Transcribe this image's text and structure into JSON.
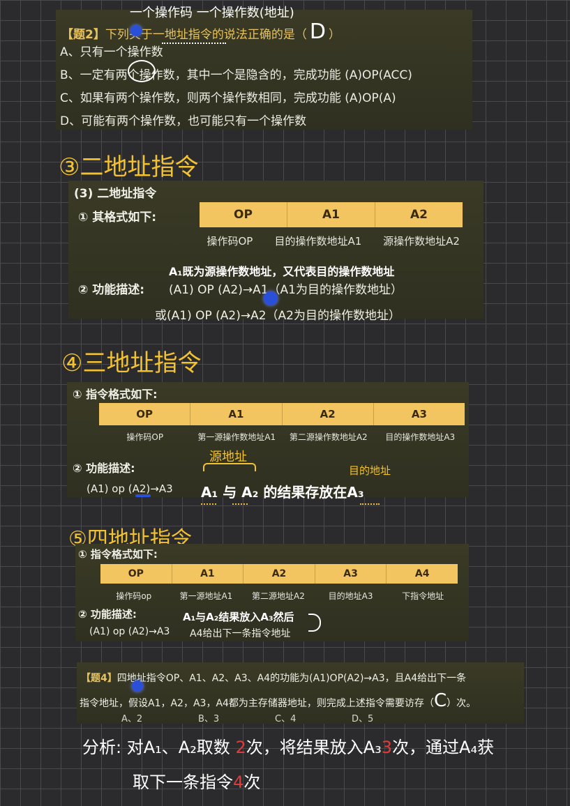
{
  "q2": {
    "annotation": "一个操作码 一个操作数(地址)",
    "title_tag": "【题2】",
    "title": "下列关于一地址指令的说法正确的是（",
    "answer": "D",
    "title_end": "）",
    "options": [
      "A、只有一个操作数",
      "B、一定有两个操作数，其中一个是隐含的，完成功能 (A)OP(ACC)",
      "C、如果有两个操作数，则两个操作数相同，完成功能 (A)OP(A)",
      "D、可能有两个操作数，也可能只有一个操作数"
    ]
  },
  "s3": {
    "heading": "③二地址指令",
    "panel_title": "(3) 二地址指令",
    "format_label": "① 其格式如下:",
    "fields": [
      "OP",
      "A1",
      "A2"
    ],
    "field_labels": [
      "操作码OP",
      "目的操作数地址A1",
      "源操作数地址A2"
    ],
    "note": "A₁既为源操作数地址，又代表目的操作数地址",
    "func_label": "② 功能描述:",
    "func1": "(A1) OP (A2)→A1（A1为目的操作数地址）",
    "func2": "或(A1) OP (A2)→A2（A2为目的操作数地址）"
  },
  "s4": {
    "heading": "④三地址指令",
    "format_label": "① 指令格式如下:",
    "fields": [
      "OP",
      "A1",
      "A2",
      "A3"
    ],
    "field_labels": [
      "操作码OP",
      "第一源操作数地址A1",
      "第二源操作数地址A2",
      "目的操作数地址A3"
    ],
    "func_label": "② 功能描述:",
    "func": "(A1) op (A2)→A3",
    "note_src": "源地址",
    "note_dst": "目的地址",
    "note_main": "A₁ 与 A₂ 的结果存放在A₃"
  },
  "s5": {
    "heading": "⑤四地址指令",
    "format_label": "① 指令格式如下:",
    "fields": [
      "OP",
      "A1",
      "A2",
      "A3",
      "A4"
    ],
    "field_labels": [
      "操作码op",
      "第一源地址A1",
      "第二源地址A2",
      "目的地址A3",
      "下指令地址"
    ],
    "func_label": "② 功能描述:",
    "func": "(A1) op (A2)→A3",
    "func_tail": "A4给出下一条指令地址",
    "note": "A₁与A₂结果放入A₃然后"
  },
  "q4": {
    "title_tag": "【题4】",
    "line1": "四地址指令OP、A1、A2、A3、A4的功能为(A1)OP(A2)→A3，且A4给出下一条",
    "line2": "指令地址，假设A1，A2，A3，A4都为主存储器地址，则完成上述指令需要访存（",
    "answer": "C",
    "line2_end": "）次。",
    "options": [
      "A、2",
      "B、3",
      "C、4",
      "D、5"
    ]
  },
  "analysis": {
    "label": "分析:",
    "part1": "对A₁、A₂取数",
    "n1": "2",
    "part2": "次，将结果放入A₃",
    "n2": "3",
    "part3": "次，通过A₄获",
    "part4": "取下一条指令",
    "n3": "4",
    "part5": "次"
  }
}
